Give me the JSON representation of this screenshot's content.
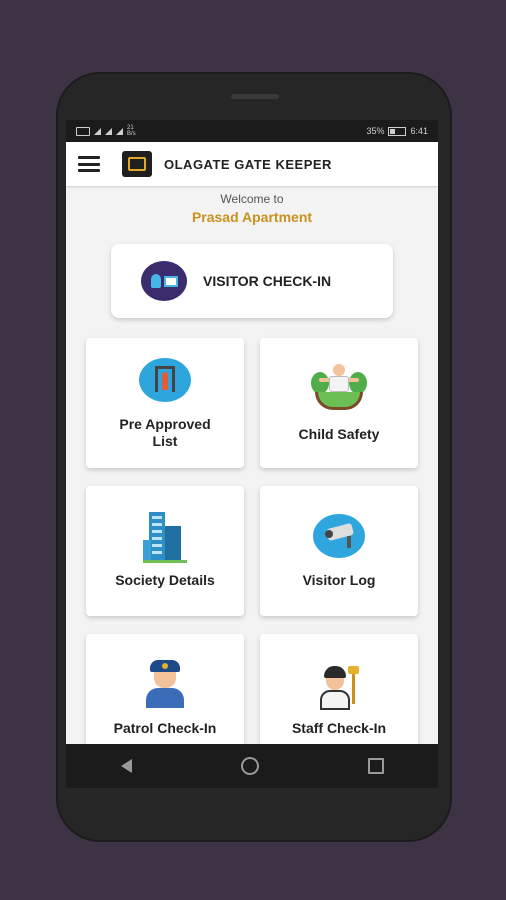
{
  "status_bar": {
    "speed": "21\nB/s",
    "battery": "35%",
    "time": "6:41"
  },
  "app_bar": {
    "title": "OLAGATE GATE KEEPER"
  },
  "header": {
    "welcome": "Welcome to",
    "apartment": "Prasad Apartment"
  },
  "checkin": {
    "label": "VISITOR CHECK-IN"
  },
  "cards": {
    "pre_approved": "Pre Approved\nList",
    "child_safety": "Child Safety",
    "society_details": "Society Details",
    "visitor_log": "Visitor Log",
    "patrol_checkin": "Patrol Check-In",
    "staff_checkin": "Staff Check-In"
  },
  "colors": {
    "background": "#3e3345",
    "accent": "#c9921e",
    "icon_blue": "#2ea6dd"
  },
  "icons": [
    "menu-icon",
    "app-logo-icon",
    "visitor-checkin-icon",
    "pre-approved-icon",
    "child-safety-icon",
    "building-icon",
    "cctv-camera-icon",
    "police-officer-icon",
    "cleaning-staff-icon",
    "back-icon",
    "home-icon",
    "recent-apps-icon"
  ]
}
